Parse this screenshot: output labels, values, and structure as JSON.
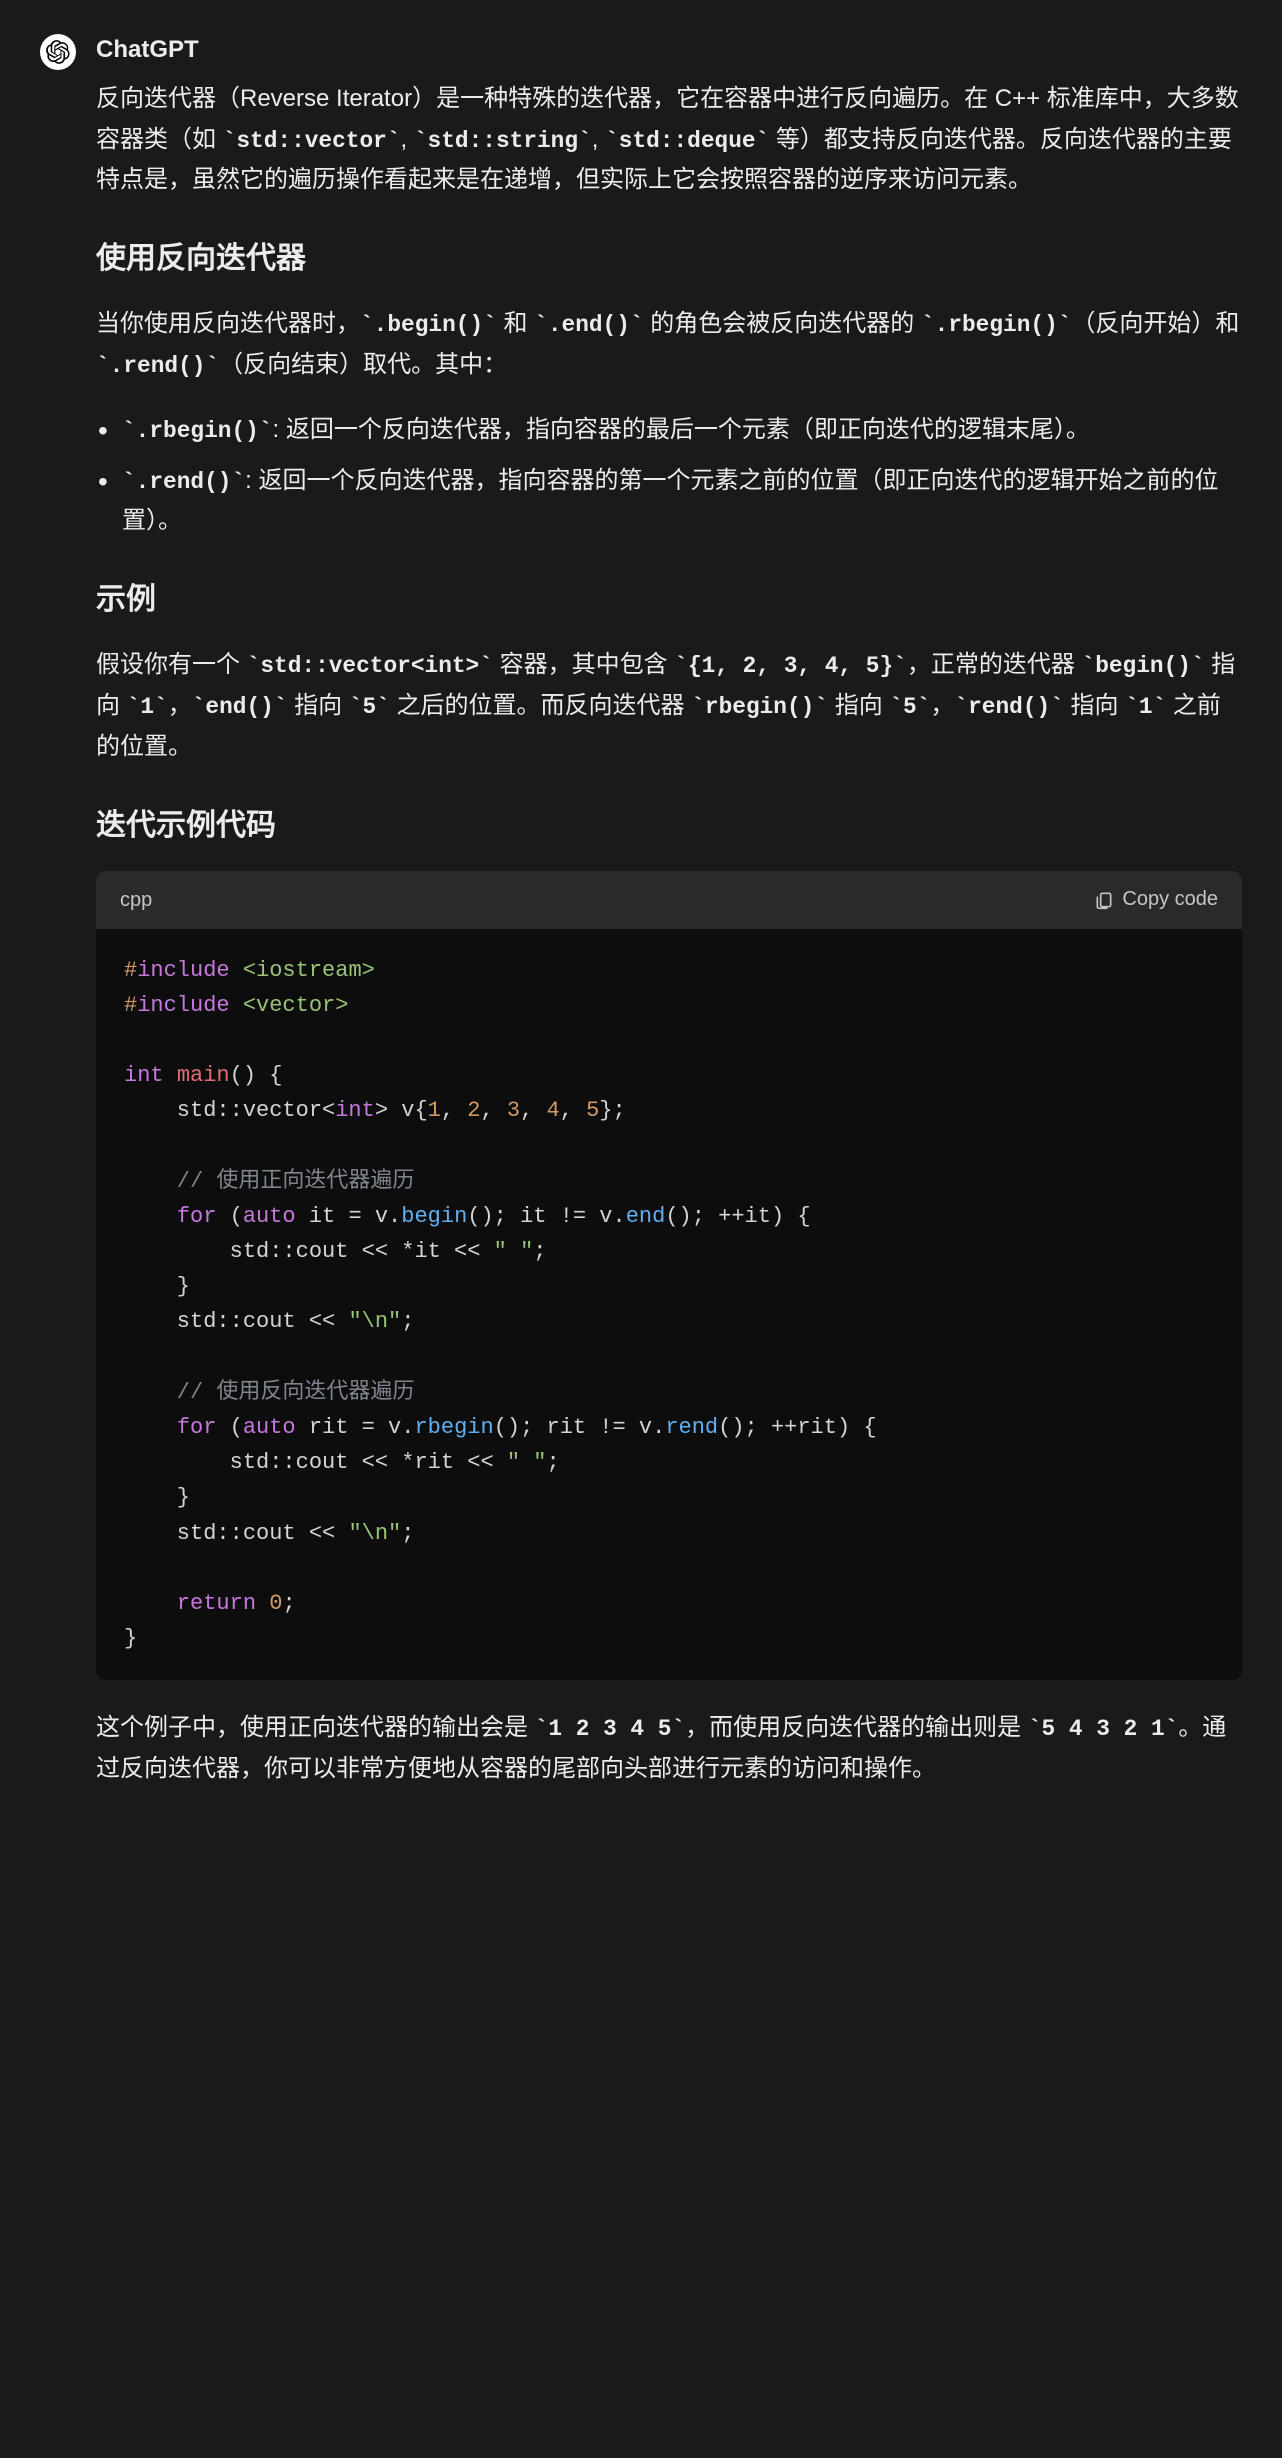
{
  "sender": "ChatGPT",
  "intro": {
    "p1a": "反向迭代器（Reverse Iterator）是一种特殊的迭代器，它在容器中进行反向遍历。在 C++ 标准库中，大多数容器类（如 ",
    "c1": "`std::vector`",
    "p1b": ", ",
    "c2": "`std::string`",
    "p1c": ", ",
    "c3": "`std::deque`",
    "p1d": " 等）都支持反向迭代器。反向迭代器的主要特点是，虽然它的遍历操作看起来是在递增，但实际上它会按照容器的逆序来访问元素。"
  },
  "h2_usage": "使用反向迭代器",
  "usage": {
    "p1a": "当你使用反向迭代器时，",
    "c1": "`.begin()`",
    "p1b": " 和 ",
    "c2": "`.end()`",
    "p1c": " 的角色会被反向迭代器的 ",
    "c3": "`.rbegin()`",
    "p1d": "（反向开始）和 ",
    "c4": "`.rend()`",
    "p1e": "（反向结束）取代。其中："
  },
  "list": {
    "li1c": "`.rbegin()`",
    "li1t": ": 返回一个反向迭代器，指向容器的最后一个元素（即正向迭代的逻辑末尾）。",
    "li2c": "`.rend()`",
    "li2t": ": 返回一个反向迭代器，指向容器的第一个元素之前的位置（即正向迭代的逻辑开始之前的位置）。"
  },
  "h2_example": "示例",
  "example": {
    "p1a": "假设你有一个 ",
    "c1": "`std::vector<int>`",
    "p1b": " 容器，其中包含 ",
    "c2": "`{1, 2, 3, 4, 5}`",
    "p1c": "，正常的迭代器 ",
    "c3": "`begin()`",
    "p1d": " 指向 ",
    "c4": "`1`",
    "p1e": "，",
    "c5": "`end()`",
    "p1f": " 指向 ",
    "c6": "`5`",
    "p1g": " 之后的位置。而反向迭代器 ",
    "c7": "`rbegin()`",
    "p1h": " 指向 ",
    "c8": "`5`",
    "p1i": "，",
    "c9": "`rend()`",
    "p1j": " 指向 ",
    "c10": "`1`",
    "p1k": " 之前的位置。"
  },
  "h2_code": "迭代示例代码",
  "codeblock": {
    "lang": "cpp",
    "copy_label": "Copy code"
  },
  "code": {
    "hash1": "#",
    "inc": "include",
    "hdr1": "<iostream>",
    "hdr2": "<vector>",
    "kw_int": "int",
    "fn_main": "main",
    "paren_open": "()",
    "brace_open": " {",
    "std_vec": "    std::vector<",
    "bltype_int": "int",
    "vec_close": "> v{",
    "n1": "1",
    "n2": "2",
    "n3": "3",
    "n4": "4",
    "n5": "5",
    "list_close": "};",
    "cm": ", ",
    "cmt1": "    // 使用正向迭代器遍历",
    "for": "for",
    "auto": "auto",
    "for1_a": "    ",
    "for1_b": " (",
    "for1_c": " it = v.",
    "begin": "begin",
    "for1_d": "(); it != v.",
    "end": "end",
    "for1_e": "(); ++it) {",
    "cout_a": "        std::cout << *it << ",
    "str_sp": "\" \"",
    "semi": ";",
    "brace_close4": "    }",
    "cout_nl_a": "    std::cout << ",
    "str_nl": "\"\\n\"",
    "cmt2": "    // 使用反向迭代器遍历",
    "for2_c": " rit = v.",
    "rbegin": "rbegin",
    "for2_d": "(); rit != v.",
    "rend": "rend",
    "for2_e": "(); ++rit) {",
    "cout2_a": "        std::cout << *rit << ",
    "return": "return",
    "ret_a": "    ",
    "ret_b": " ",
    "zero": "0",
    "brace_close0": "}"
  },
  "outro": {
    "p1a": "这个例子中，使用正向迭代器的输出会是 ",
    "c1": "`1 2 3 4 5`",
    "p1b": "，而使用反向迭代器的输出则是 ",
    "c2": "`5 4 3 2 1`",
    "p1c": "。通过反向迭代器，你可以非常方便地从容器的尾部向头部进行元素的访问和操作。"
  }
}
